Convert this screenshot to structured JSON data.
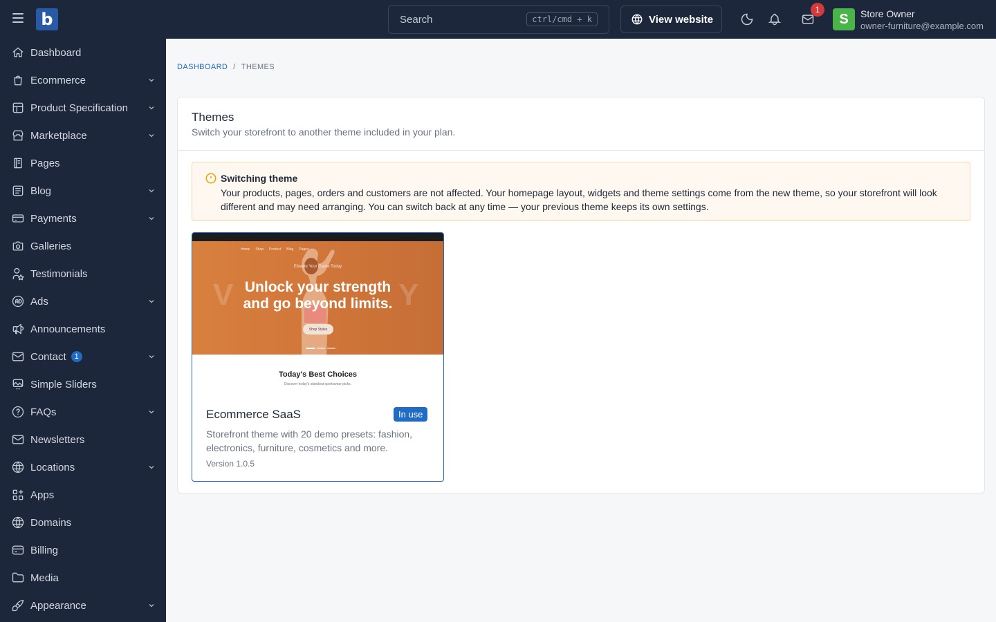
{
  "topbar": {
    "search_placeholder": "Search",
    "search_shortcut": "ctrl/cmd + k",
    "view_website": "View website",
    "inbox_badge": "1",
    "avatar_letter": "S",
    "user_name": "Store Owner",
    "user_email": "owner-furniture@example.com"
  },
  "sidebar": {
    "items": [
      {
        "label": "Dashboard",
        "icon": "home-icon",
        "expandable": false
      },
      {
        "label": "Ecommerce",
        "icon": "shopping-bag-icon",
        "expandable": true
      },
      {
        "label": "Product Specification",
        "icon": "table-layout-icon",
        "expandable": true
      },
      {
        "label": "Marketplace",
        "icon": "store-icon",
        "expandable": true
      },
      {
        "label": "Pages",
        "icon": "notebook-icon",
        "expandable": false
      },
      {
        "label": "Blog",
        "icon": "article-icon",
        "expandable": true
      },
      {
        "label": "Payments",
        "icon": "credit-card-icon",
        "expandable": true
      },
      {
        "label": "Galleries",
        "icon": "camera-icon",
        "expandable": false
      },
      {
        "label": "Testimonials",
        "icon": "user-star-icon",
        "expandable": false
      },
      {
        "label": "Ads",
        "icon": "ad-icon",
        "expandable": true
      },
      {
        "label": "Announcements",
        "icon": "speakerphone-icon",
        "expandable": false
      },
      {
        "label": "Contact",
        "icon": "mail-icon",
        "expandable": true,
        "badge": "1"
      },
      {
        "label": "Simple Sliders",
        "icon": "slideshow-icon",
        "expandable": false
      },
      {
        "label": "FAQs",
        "icon": "help-circle-icon",
        "expandable": true
      },
      {
        "label": "Newsletters",
        "icon": "mail-icon",
        "expandable": false
      },
      {
        "label": "Locations",
        "icon": "world-icon",
        "expandable": true
      },
      {
        "label": "Apps",
        "icon": "apps-icon",
        "expandable": false
      },
      {
        "label": "Domains",
        "icon": "world-icon",
        "expandable": false
      },
      {
        "label": "Billing",
        "icon": "receipt-icon",
        "expandable": false
      },
      {
        "label": "Media",
        "icon": "folder-icon",
        "expandable": false
      },
      {
        "label": "Appearance",
        "icon": "brush-icon",
        "expandable": true
      }
    ]
  },
  "breadcrumb": {
    "home": "DASHBOARD",
    "separator": "/",
    "current": "THEMES"
  },
  "card": {
    "title": "Themes",
    "subtitle": "Switch your storefront to another theme included in your plan."
  },
  "alert": {
    "title": "Switching theme",
    "body": "Your products, pages, orders and customers are not affected. Your homepage layout, widgets and theme settings come from the new theme, so your storefront will look different and may need arranging. You can switch back at any time — your previous theme keeps its own settings."
  },
  "theme": {
    "name": "Ecommerce SaaS",
    "status_badge": "In use",
    "description": "Storefront theme with 20 demo presets: fashion, electronics, furniture, cosmetics and more.",
    "version": "Version 1.0.5",
    "preview": {
      "small_text": "Elevate Your Game Today",
      "headline_line1": "Unlock your strength",
      "headline_line2": "and go beyond limits.",
      "button": "Shop Styles",
      "nav": [
        "Home",
        "Shop",
        "Product",
        "Blog",
        "Pages"
      ],
      "section_title": "Today's Best Choices",
      "section_sub": "Discover today's standout sportswear picks."
    }
  },
  "colors": {
    "sidebar_bg": "#1d273b",
    "accent": "#206bc4",
    "badge_red": "#d63939",
    "avatar_green": "#4ab34a",
    "alert_bg": "#fef8f0"
  }
}
